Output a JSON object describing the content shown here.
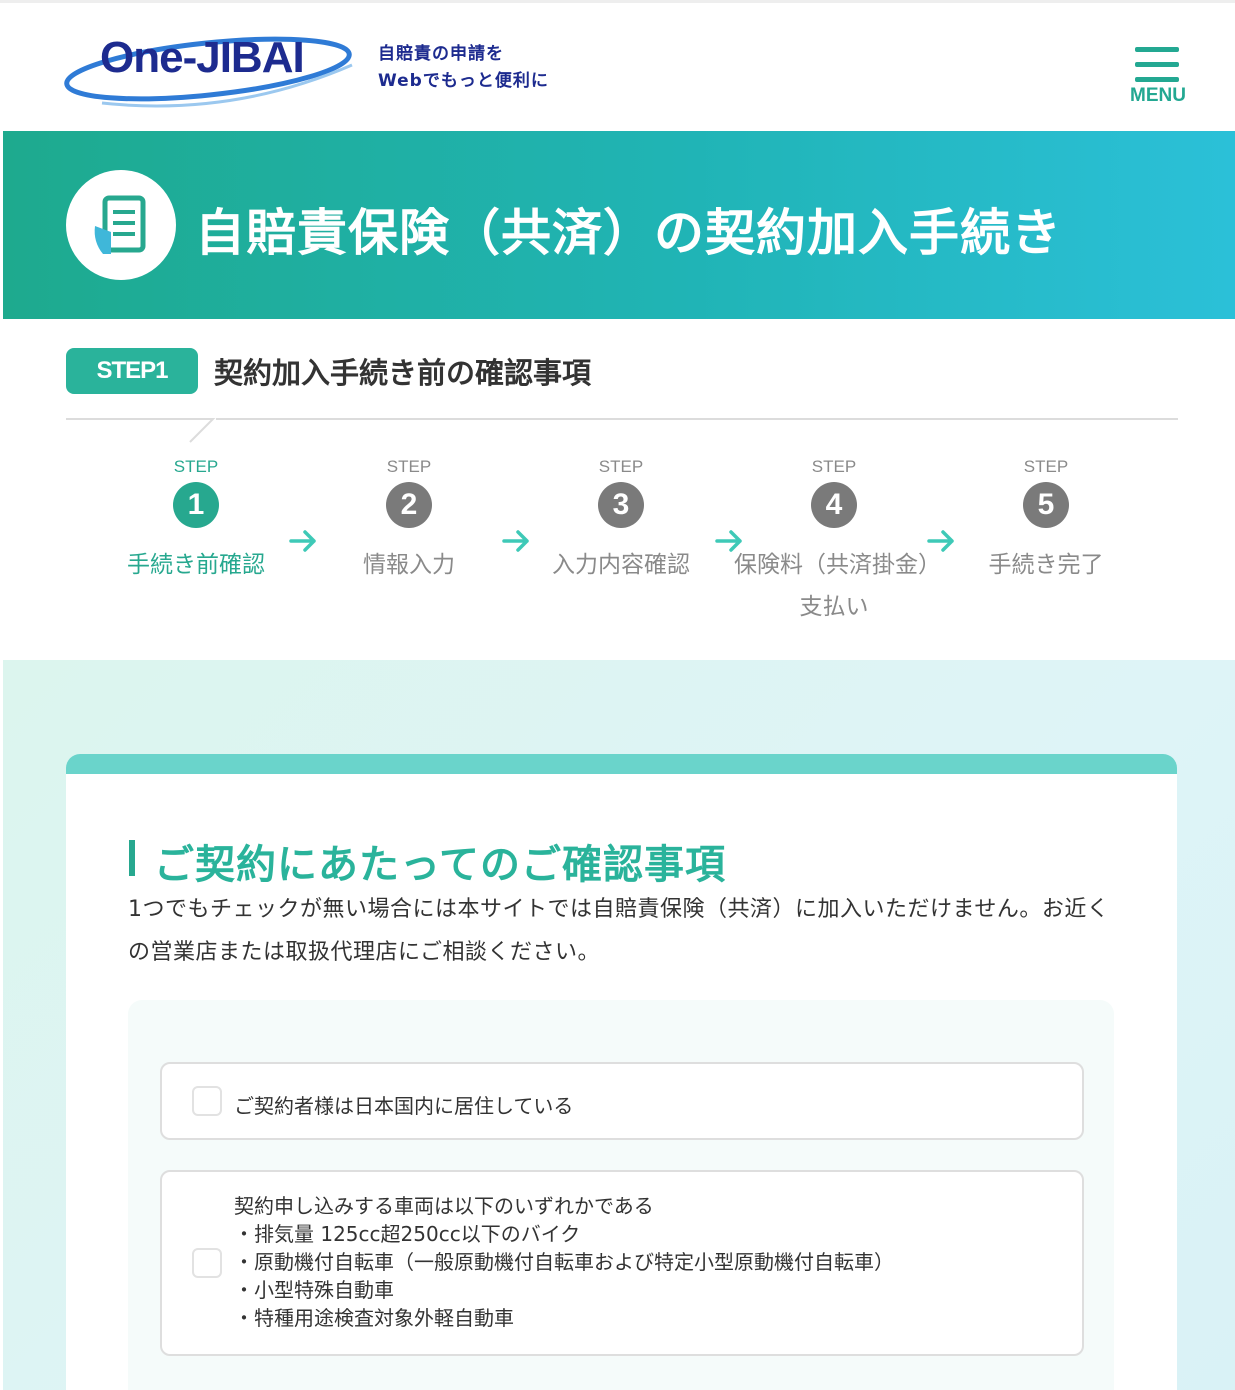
{
  "header": {
    "logo_text": "One-JIBAI",
    "tagline_line1": "自賠責の申請を",
    "tagline_line2": "Webでもっと便利に",
    "menu_label": "MENU"
  },
  "banner": {
    "title": "自賠責保険（共済）の契約加入手続き",
    "icon": "document-icon"
  },
  "step_heading": {
    "badge": "STEP1",
    "title": "契約加入手続き前の確認事項"
  },
  "progress": {
    "steps": [
      {
        "label": "STEP",
        "number": "1",
        "name_line1": "手続き前確認",
        "name_line2": "",
        "active": true
      },
      {
        "label": "STEP",
        "number": "2",
        "name_line1": "情報入力",
        "name_line2": "",
        "active": false
      },
      {
        "label": "STEP",
        "number": "3",
        "name_line1": "入力内容確認",
        "name_line2": "",
        "active": false
      },
      {
        "label": "STEP",
        "number": "4",
        "name_line1": "保険料（共済掛金）",
        "name_line2": "支払い",
        "active": false
      },
      {
        "label": "STEP",
        "number": "5",
        "name_line1": "手続き完了",
        "name_line2": "",
        "active": false
      }
    ],
    "arrow_icon": "arrow-right-icon"
  },
  "confirmation": {
    "title": "ご契約にあたってのご確認事項",
    "description": "1つでもチェックが無い場合には本サイトでは自賠責保険（共済）に加入いただけません。お近くの営業店または取扱代理店にご相談ください。",
    "items": [
      {
        "text": "ご契約者様は日本国内に居住している",
        "checked": false
      },
      {
        "text": "契約申し込みする車両は以下のいずれかである",
        "bullets": [
          "・排気量 125cc超250cc以下のバイク",
          "・原動機付自転車（一般原動機付自転車および特定小型原動機付自転車）",
          "・小型特殊自動車",
          "・特種用途検査対象外軽自動車"
        ],
        "checked": false
      }
    ]
  },
  "colors": {
    "brand_navy": "#1d2b8f",
    "accent_green": "#27a88f",
    "banner_start": "#1eaa8e",
    "banner_end": "#2bc0d8",
    "inactive_gray": "#7a7a7a"
  }
}
